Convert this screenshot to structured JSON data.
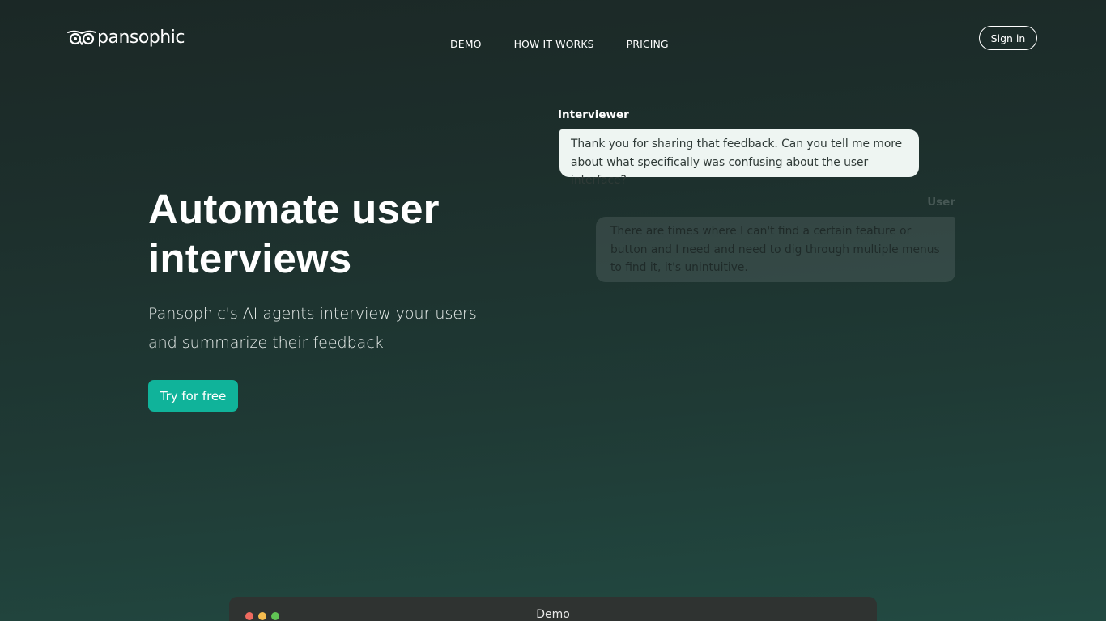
{
  "brand": {
    "name": "pansophic",
    "logo_icon": "owl-glasses-icon"
  },
  "nav": {
    "items": [
      {
        "label": "DEMO"
      },
      {
        "label": "HOW IT WORKS"
      },
      {
        "label": "PRICING"
      }
    ],
    "signin_label": "Sign in"
  },
  "hero": {
    "title": "Automate user interviews",
    "subtitle": "Pansophic's AI agents interview your users and summarize their feedback",
    "cta_label": "Try for free"
  },
  "chat": {
    "interviewer_label": "Interviewer",
    "interviewer_message": "Thank you for sharing that feedback. Can you tell me more about what specifically was confusing about the user interface?",
    "user_label": "User",
    "user_message": "There are times where I can't find a certain feature or button and I need and need to dig through multiple menus to find it, it's unintuitive."
  },
  "demo_window": {
    "title": "Demo",
    "dot_colors": [
      "#ee6a5f",
      "#f5bd4f",
      "#61c454"
    ]
  },
  "colors": {
    "accent": "#10b39a",
    "background_top": "#1b2826",
    "background_bottom": "#224a42"
  }
}
